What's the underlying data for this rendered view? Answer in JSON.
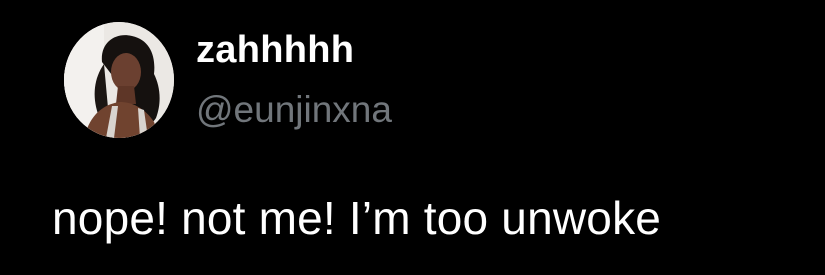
{
  "tweet": {
    "author": {
      "display_name": "zahhhhh",
      "handle": "@eunjinxna",
      "avatar_icon": "profile-photo"
    },
    "text": "nope! not me! I’m too unwoke"
  },
  "colors": {
    "background": "#000000",
    "primary_text": "#ffffff",
    "secondary_text": "#71767b"
  }
}
